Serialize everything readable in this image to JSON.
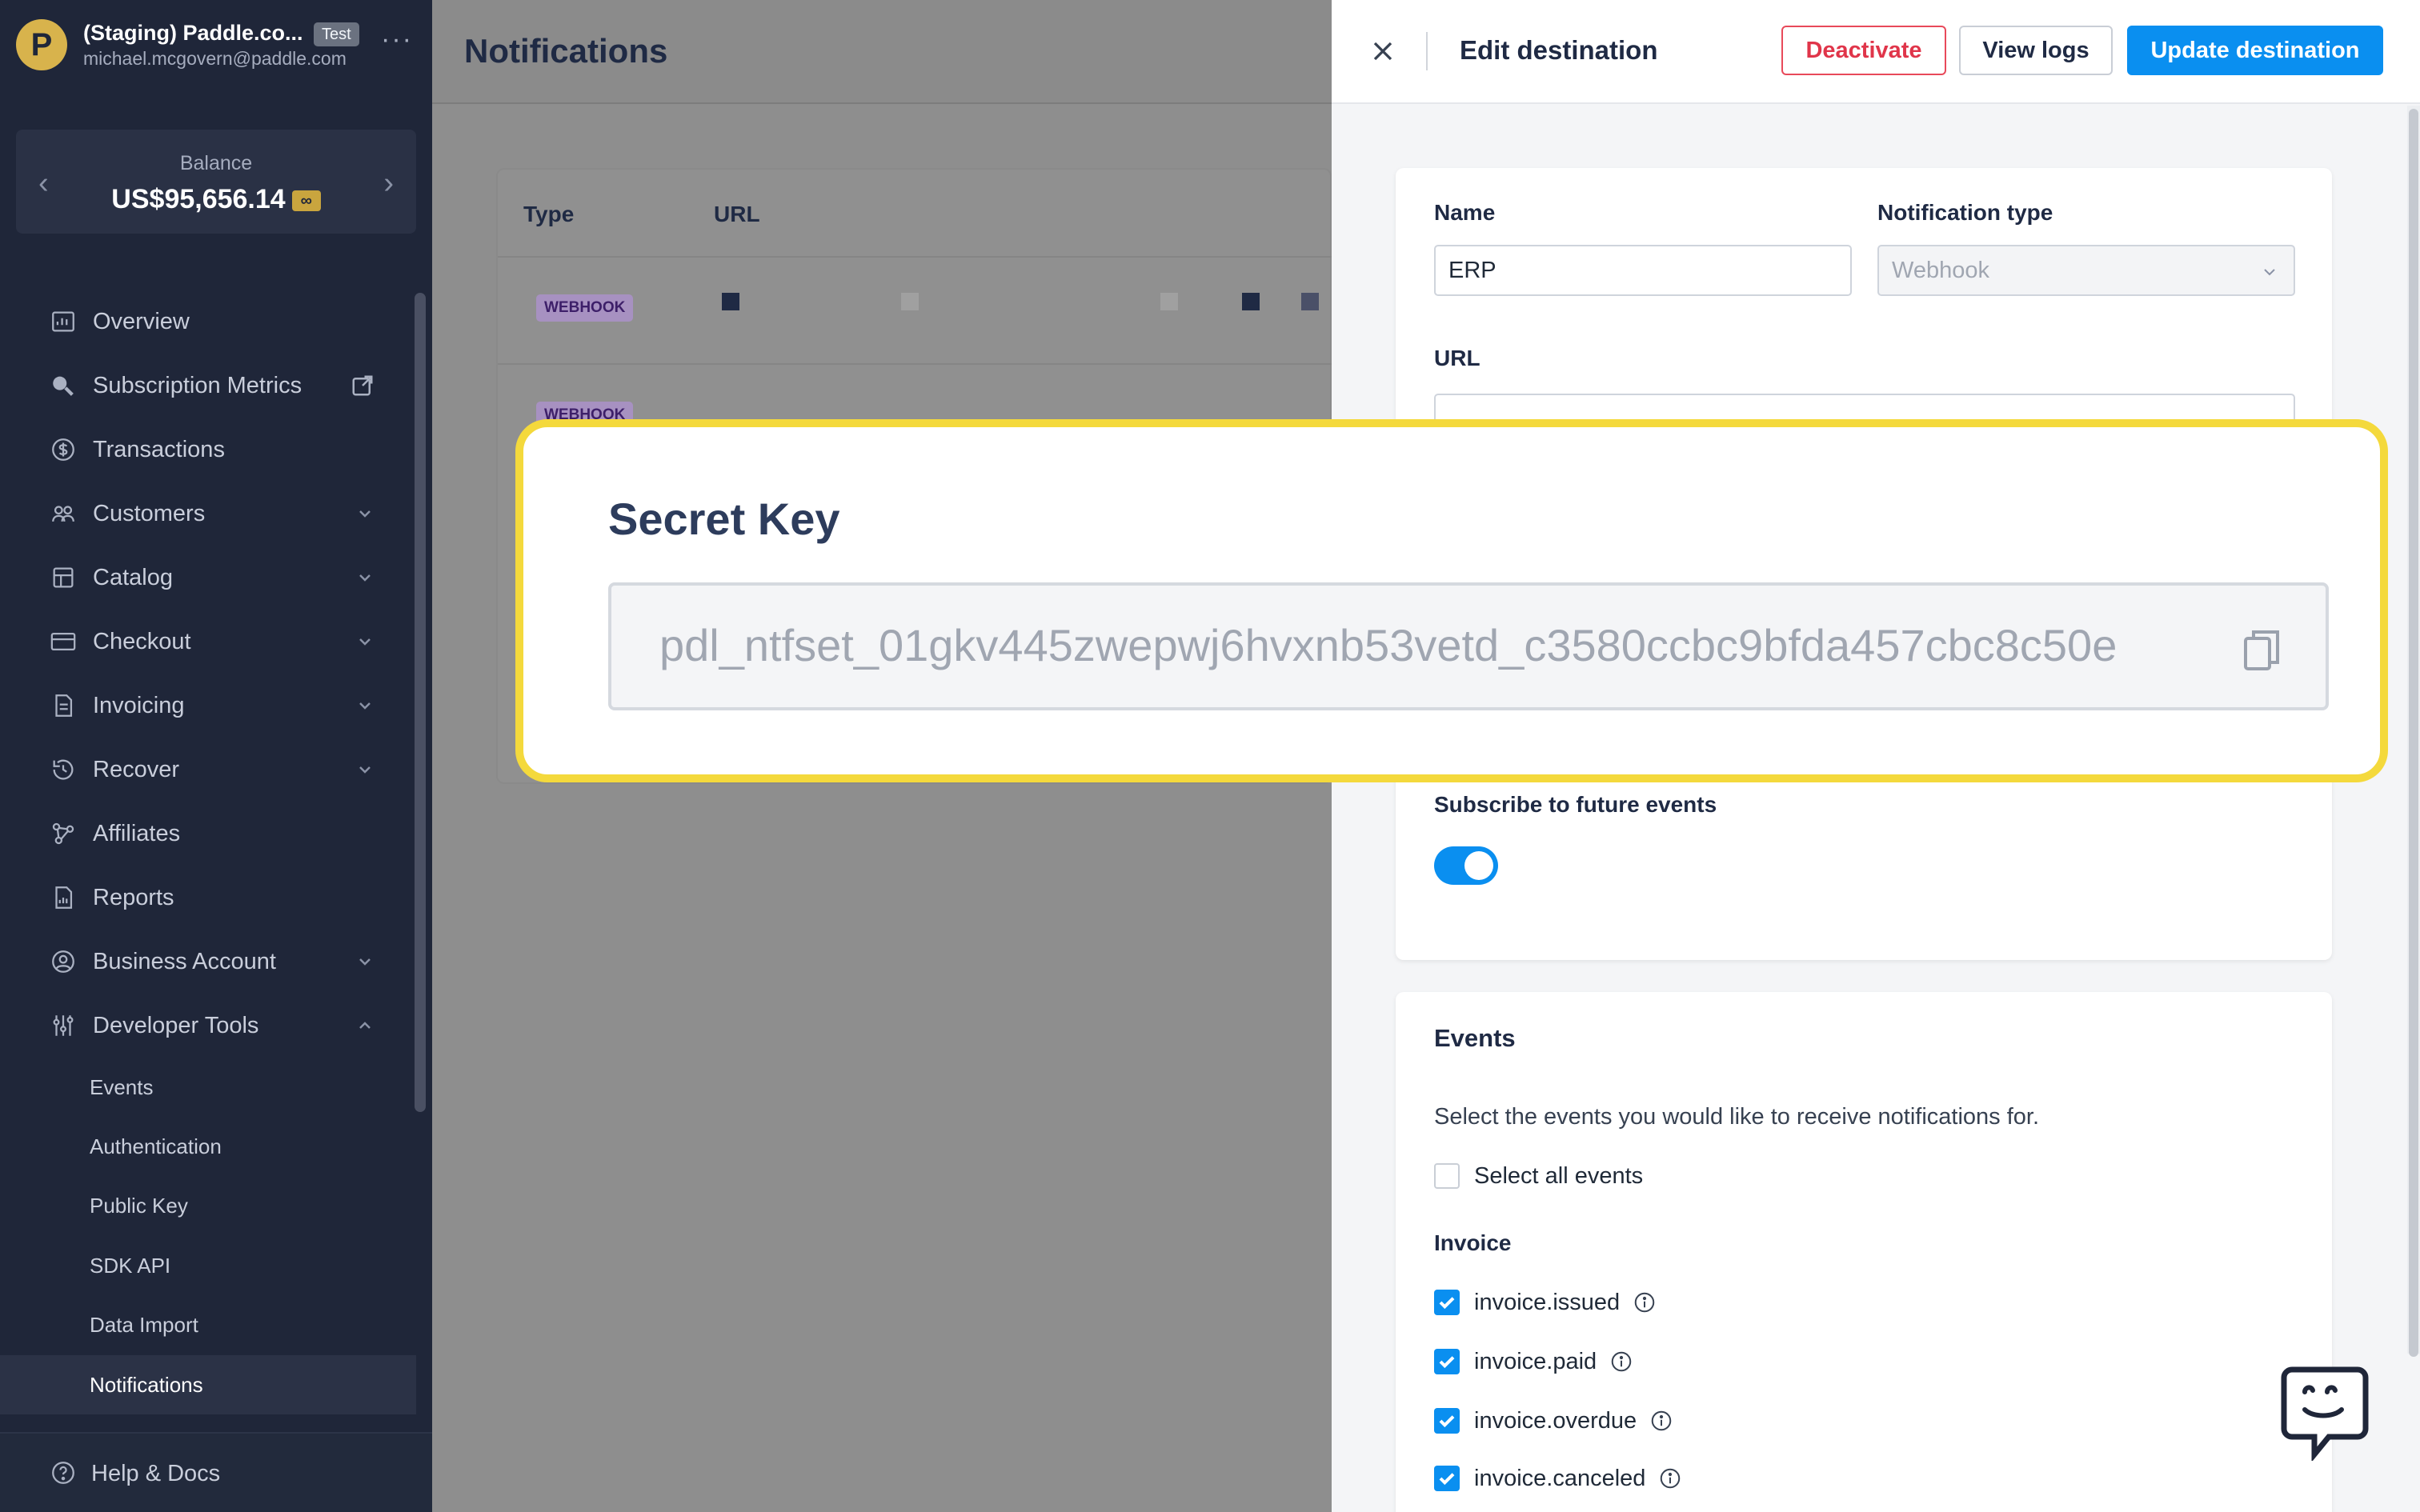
{
  "sidebar": {
    "account": {
      "logo_letter": "P",
      "name": "(Staging) Paddle.co...",
      "badge": "Test",
      "email": "michael.mcgovern@paddle.com",
      "more": "···"
    },
    "balance": {
      "label": "Balance",
      "value": "US$95,656.14",
      "badge": "∞"
    },
    "items": [
      {
        "label": "Overview",
        "icon": "overview-icon",
        "chevron": false
      },
      {
        "label": "Subscription Metrics",
        "icon": "subscription-metrics-icon",
        "external": true
      },
      {
        "label": "Transactions",
        "icon": "dollar-circle-icon",
        "chevron": false
      },
      {
        "label": "Customers",
        "icon": "customers-icon",
        "chevron": true
      },
      {
        "label": "Catalog",
        "icon": "catalog-icon",
        "chevron": true
      },
      {
        "label": "Checkout",
        "icon": "card-icon",
        "chevron": true
      },
      {
        "label": "Invoicing",
        "icon": "invoice-icon",
        "chevron": true
      },
      {
        "label": "Recover",
        "icon": "recover-icon",
        "chevron": true
      },
      {
        "label": "Affiliates",
        "icon": "affiliates-icon",
        "chevron": false
      },
      {
        "label": "Reports",
        "icon": "reports-icon",
        "chevron": false
      },
      {
        "label": "Business Account",
        "icon": "business-account-icon",
        "chevron": true
      },
      {
        "label": "Developer Tools",
        "icon": "developer-tools-icon",
        "chevron_up": true
      }
    ],
    "sub_items": [
      {
        "label": "Events"
      },
      {
        "label": "Authentication"
      },
      {
        "label": "Public Key"
      },
      {
        "label": "SDK API"
      },
      {
        "label": "Data Import"
      },
      {
        "label": "Notifications",
        "active": true
      }
    ],
    "help": "Help  &  Docs"
  },
  "main": {
    "title": "Notifications",
    "table": {
      "headers": [
        "Type",
        "URL"
      ],
      "rows": [
        {
          "type": "WEBHOOK"
        },
        {
          "type": "WEBHOOK"
        }
      ]
    }
  },
  "drawer": {
    "title": "Edit destination",
    "buttons": {
      "deactivate": "Deactivate",
      "view_logs": "View logs",
      "update": "Update destination"
    },
    "form": {
      "name_label": "Name",
      "name_value": "ERP",
      "type_label": "Notification type",
      "type_value": "Webhook",
      "url_label": "URL",
      "future_label": "Subscribe to future events",
      "future_on": true
    },
    "events": {
      "title": "Events",
      "description": "Select the events you would like to receive notifications for.",
      "select_all": "Select all events",
      "group": "Invoice",
      "items": [
        {
          "label": "invoice.issued",
          "checked": true
        },
        {
          "label": "invoice.paid",
          "checked": true
        },
        {
          "label": "invoice.overdue",
          "checked": true
        },
        {
          "label": "invoice.canceled",
          "checked": true
        }
      ]
    }
  },
  "callout": {
    "title": "Secret Key",
    "key": "pdl_ntfset_01gkv445zwepwj6hvxnb53vetd_c3580ccbc9bfda457cbc8c50e"
  },
  "colors": {
    "sidebar_bg": "#1f2639",
    "primary": "#0a8ff0",
    "danger": "#e0354a",
    "highlight": "#f4d93c"
  }
}
